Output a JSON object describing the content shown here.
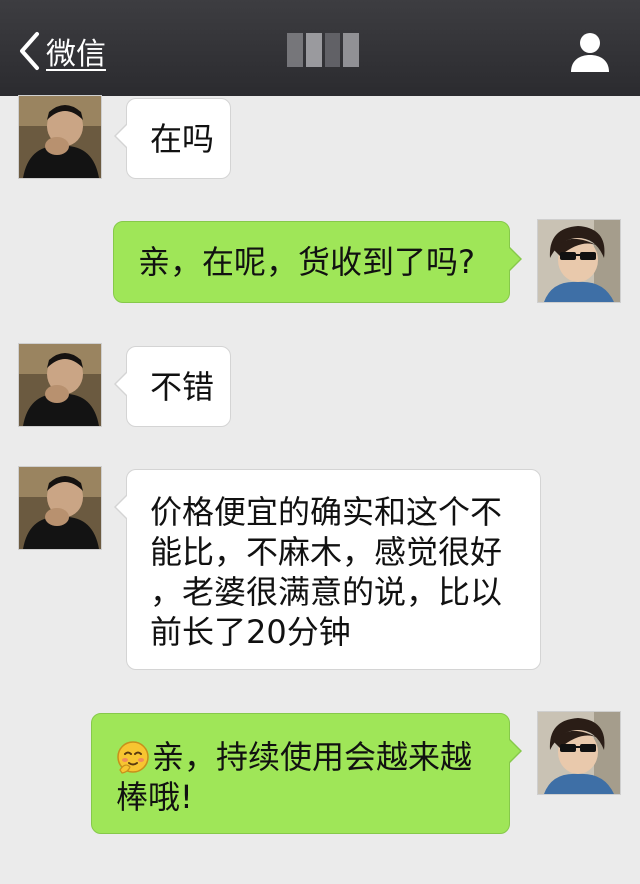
{
  "nav": {
    "back_label": "微信",
    "back_icon": "chevron-left-icon",
    "profile_icon": "person-icon",
    "title_blurred": true
  },
  "colors": {
    "navbar": "#2f2f33",
    "chat_background": "#ebebeb",
    "incoming_bubble": "#ffffff",
    "outgoing_bubble": "#9fe658"
  },
  "messages": [
    {
      "direction": "incoming",
      "text": "在吗"
    },
    {
      "direction": "outgoing",
      "text": "亲，在呢，货收到了吗?"
    },
    {
      "direction": "incoming",
      "text": "不错"
    },
    {
      "direction": "incoming",
      "lines": [
        "价格便宜的确实和这个不",
        "能比，不麻木，感觉很好",
        "，老婆很满意的说，比以",
        "前长了20分钟"
      ]
    },
    {
      "direction": "outgoing",
      "emoji": "shy-smile-emoji-icon",
      "lines": [
        "亲，持续使用会越来越",
        "棒哦!"
      ]
    }
  ]
}
